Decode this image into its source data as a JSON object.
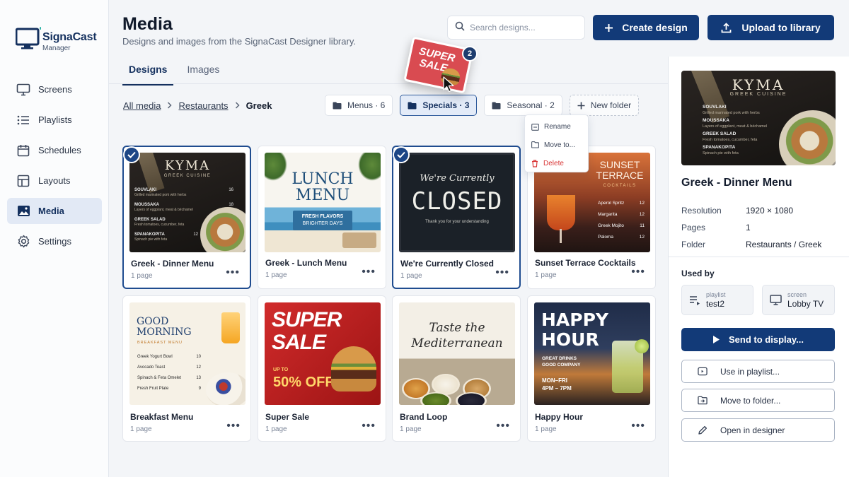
{
  "app": {
    "name": "SignaCast",
    "sub": "Manager"
  },
  "nav": [
    {
      "label": "Screens",
      "icon": "monitor-icon"
    },
    {
      "label": "Playlists",
      "icon": "list-icon"
    },
    {
      "label": "Schedules",
      "icon": "calendar-icon"
    },
    {
      "label": "Layouts",
      "icon": "layout-icon"
    },
    {
      "label": "Media",
      "icon": "image-icon",
      "active": true
    },
    {
      "label": "Settings",
      "icon": "gear-icon"
    }
  ],
  "header": {
    "title": "Media",
    "subtitle": "Designs and images from the SignaCast Designer library.",
    "search_placeholder": "Search designs...",
    "create_label": "Create design",
    "upload_label": "Upload to library"
  },
  "tabs": [
    {
      "label": "Designs",
      "active": true
    },
    {
      "label": "Images"
    }
  ],
  "breadcrumb": {
    "items": [
      "All media",
      "Restaurants"
    ],
    "current": "Greek"
  },
  "folders": [
    {
      "label": "Menus · 6"
    },
    {
      "label": "Specials · 3",
      "active": true
    },
    {
      "label": "Seasonal · 2"
    },
    {
      "label": "New folder",
      "new": true
    }
  ],
  "context_menu": {
    "items": [
      {
        "label": "Rename",
        "icon": "rename-icon"
      },
      {
        "label": "Move to...",
        "icon": "folder-move-icon"
      },
      {
        "label": "Delete",
        "icon": "trash-icon",
        "danger": true
      }
    ]
  },
  "drag": {
    "count": "2",
    "thumb_line1": "SUPER",
    "thumb_line2": "SALE"
  },
  "cards": [
    {
      "name": "Greek - Dinner Menu",
      "pages": "1 page",
      "selected": true
    },
    {
      "name": "Greek - Lunch Menu",
      "pages": "1 page"
    },
    {
      "name": "We're Currently Closed",
      "pages": "1 page",
      "selected": true
    },
    {
      "name": "Sunset Terrace Cocktails",
      "pages": "1 page"
    },
    {
      "name": "Breakfast Menu",
      "pages": "1 page"
    },
    {
      "name": "Super Sale",
      "pages": "1 page"
    },
    {
      "name": "Brand Loop",
      "pages": "1 page"
    },
    {
      "name": "Happy Hour",
      "pages": "1 page"
    }
  ],
  "art": {
    "kyma": {
      "title": "KYMA",
      "sub": "GREEK CUISINE",
      "items": [
        {
          "name": "SOUVLAKI",
          "desc": "Grilled marinated pork with herbs",
          "price": "16"
        },
        {
          "name": "MOUSSAKA",
          "desc": "Layers of eggplant, meat & béchamel",
          "price": "18"
        },
        {
          "name": "GREEK SALAD",
          "desc": "Fresh tomatoes, cucumber, feta",
          "price": "14"
        },
        {
          "name": "SPANAKOPITA",
          "desc": "Spinach pie with feta",
          "price": "12"
        }
      ]
    },
    "lunch": {
      "line1": "LUNCH",
      "line2": "MENU",
      "tag1": "FRESH FLAVORS",
      "tag2": "BRIGHTER DAYS"
    },
    "closed": {
      "script": "We're Currently",
      "big": "CLOSED",
      "small": "Thank you for your understanding"
    },
    "sunset": {
      "line1": "SUNSET",
      "line2": "TERRACE",
      "line3": "COCKTAILS",
      "items": [
        {
          "name": "Aperol Spritz",
          "price": "12"
        },
        {
          "name": "Margarita",
          "price": "12"
        },
        {
          "name": "Greek Mojito",
          "price": "11"
        },
        {
          "name": "Paloma",
          "price": "12"
        }
      ]
    },
    "breakfast": {
      "line1": "GOOD",
      "line2": "MORNING",
      "line3": "BREAKFAST MENU",
      "items": [
        {
          "name": "Greek Yogurt Bowl",
          "price": "10"
        },
        {
          "name": "Avocado Toast",
          "price": "12"
        },
        {
          "name": "Spinach & Feta Omelet",
          "price": "13"
        },
        {
          "name": "Fresh Fruit Plate",
          "price": "9"
        }
      ]
    },
    "sale": {
      "line1": "SUPER",
      "line2": "SALE",
      "upto": "UP TO",
      "off": "50% OFF"
    },
    "brand": {
      "line1": "Taste the",
      "line2": "Mediterranean"
    },
    "happy": {
      "line1": "HAPPY",
      "line2": "HOUR",
      "d1": "GREAT DRINKS",
      "d2": "GOOD COMPANY",
      "d3": "MON–FRI",
      "d4": "4PM – 7PM"
    }
  },
  "panel": {
    "title": "Greek - Dinner Menu",
    "meta": [
      {
        "k": "Resolution",
        "v": "1920 × 1080"
      },
      {
        "k": "Pages",
        "v": "1"
      },
      {
        "k": "Folder",
        "v": "Restaurants / Greek"
      }
    ],
    "used_by": "Used by",
    "chips": [
      {
        "type": "playlist",
        "value": "test2"
      },
      {
        "type": "screen",
        "value": "Lobby TV"
      }
    ],
    "send_label": "Send to display...",
    "actions": [
      "Use in playlist...",
      "Move to folder...",
      "Open in designer"
    ]
  },
  "colors": {
    "primary": "#123a78",
    "danger": "#d93636",
    "selected": "#1f4c8f"
  }
}
